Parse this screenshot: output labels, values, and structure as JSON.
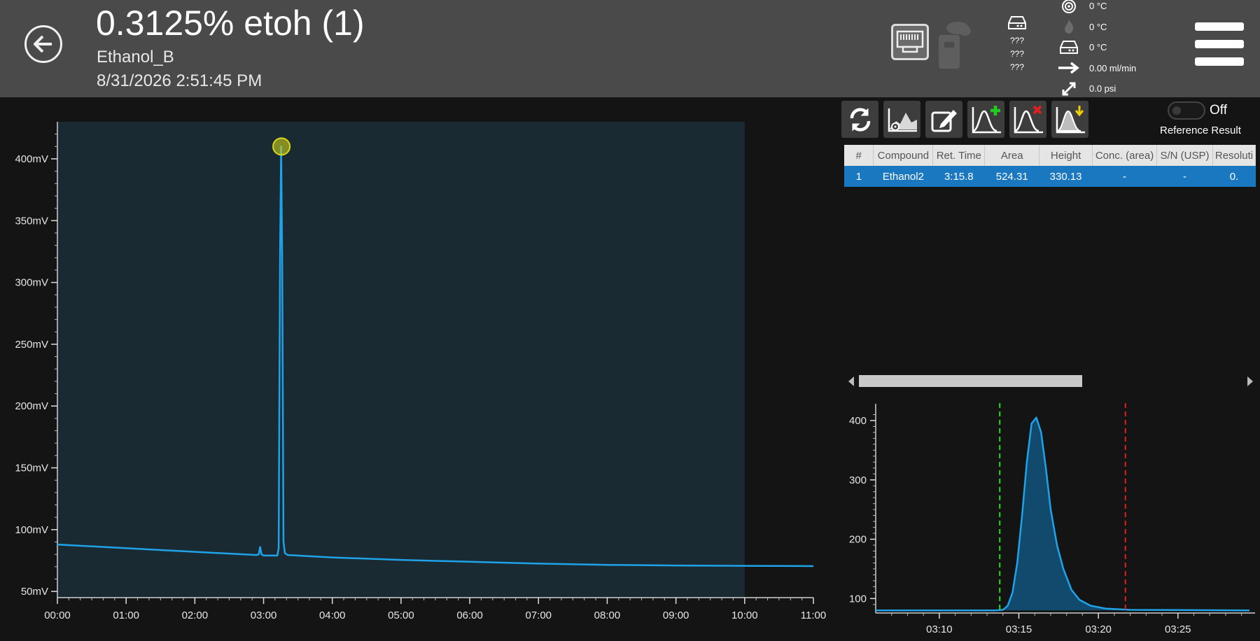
{
  "header": {
    "title": "0.3125% etoh (1)",
    "method": "Ethanol_B",
    "timestamp": "8/31/2026 2:51:45 PM",
    "drive_values": [
      "???",
      "???",
      "???"
    ],
    "status": [
      {
        "icon": "target-icon",
        "value": "0 °C"
      },
      {
        "icon": "flame-icon",
        "value": "0 °C"
      },
      {
        "icon": "drive-temp-icon",
        "value": "0 °C"
      },
      {
        "icon": "flow-arrow-icon",
        "value": "0.00 ml/min"
      },
      {
        "icon": "pressure-icon",
        "value": "0.0  psi"
      }
    ]
  },
  "toolbar": {
    "buttons": [
      "refresh-icon",
      "integration-settings-icon",
      "edit-icon",
      "add-peak-icon",
      "remove-peak-icon",
      "fill-peak-icon"
    ],
    "toggle_state": "Off",
    "reference_label": "Reference Result"
  },
  "table": {
    "columns": [
      "#",
      "Compound",
      "Ret. Time",
      "Area",
      "Height",
      "Conc. (area)",
      "S/N (USP)",
      "Resoluti"
    ],
    "rows": [
      {
        "num": "1",
        "compound": "Ethanol2",
        "ret_time": "3:15.8",
        "area": "524.31",
        "height": "330.13",
        "conc": "-",
        "sn": "-",
        "res": "0."
      }
    ]
  },
  "chart_data": [
    {
      "type": "line",
      "title": "",
      "xlabel": "",
      "ylabel": "",
      "x_tick_labels": [
        "00:00",
        "01:00",
        "02:00",
        "03:00",
        "04:00",
        "05:00",
        "06:00",
        "07:00",
        "08:00",
        "09:00",
        "10:00",
        "11:00"
      ],
      "y_tick_labels": [
        "50mV",
        "100mV",
        "150mV",
        "200mV",
        "250mV",
        "300mV",
        "350mV",
        "400mV"
      ],
      "xlim_min": [
        0,
        11
      ],
      "ylim_mv": [
        45,
        430
      ],
      "series": [
        {
          "x_min": [
            0,
            1,
            2,
            2.9,
            2.93,
            2.95,
            2.97,
            3.0,
            3.2,
            3.22,
            3.24,
            3.255,
            3.27,
            3.29,
            3.31,
            3.35,
            4,
            5,
            6,
            7,
            8,
            9,
            10,
            11
          ],
          "y_mv": [
            88,
            85,
            82,
            79.5,
            80,
            86,
            80,
            79,
            79,
            85,
            320,
            410,
            320,
            90,
            81,
            79.5,
            77.5,
            75.5,
            74,
            72.5,
            71.5,
            71,
            70.7,
            70.5
          ]
        }
      ],
      "marker": {
        "x_min": 3.26,
        "y_mv": 410
      },
      "shaded_region_x_min": [
        0,
        10
      ]
    },
    {
      "type": "area",
      "title": "",
      "x_tick_labels": [
        "03:10",
        "03:15",
        "03:20",
        "03:25"
      ],
      "y_tick_labels": [
        "100",
        "200",
        "300",
        "400"
      ],
      "xlim_sec": [
        186,
        209.5
      ],
      "ylim": [
        78,
        420
      ],
      "series": [
        {
          "x_sec": [
            186,
            193.5,
            194,
            194.3,
            194.6,
            194.9,
            195.2,
            195.5,
            195.8,
            196.1,
            196.4,
            196.7,
            197.0,
            197.4,
            197.8,
            198.3,
            198.8,
            199.5,
            200.5,
            202,
            209.5
          ],
          "y": [
            80,
            80,
            81,
            88,
            110,
            160,
            240,
            330,
            395,
            405,
            380,
            320,
            250,
            190,
            150,
            115,
            98,
            88,
            83,
            81,
            80
          ]
        }
      ],
      "start_marker_sec": 193.8,
      "end_marker_sec": 201.7
    }
  ]
}
